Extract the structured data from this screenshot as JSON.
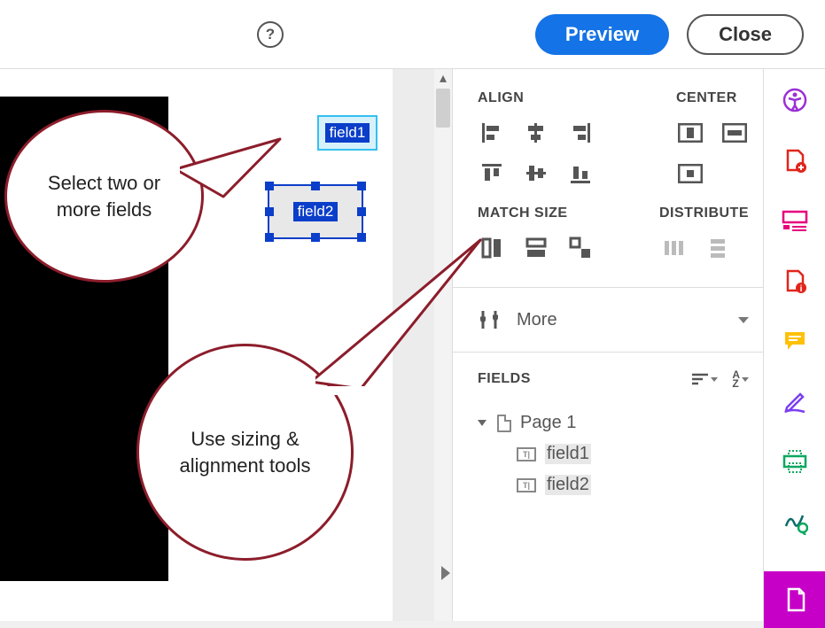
{
  "toolbar": {
    "preview_label": "Preview",
    "close_label": "Close",
    "help_label": "?"
  },
  "canvas": {
    "field1_label": "field1",
    "field2_label": "field2"
  },
  "callouts": {
    "select_multi": "Select two or more fields",
    "use_tools": "Use sizing & alignment tools"
  },
  "panel": {
    "align_title": "ALIGN",
    "center_title": "CENTER",
    "match_title": "MATCH SIZE",
    "distribute_title": "DISTRIBUTE",
    "more_label": "More",
    "fields_title": "FIELDS",
    "sort_az": "A\nZ"
  },
  "tree": {
    "page_label": "Page 1",
    "items": [
      {
        "label": "field1"
      },
      {
        "label": "field2"
      }
    ]
  }
}
